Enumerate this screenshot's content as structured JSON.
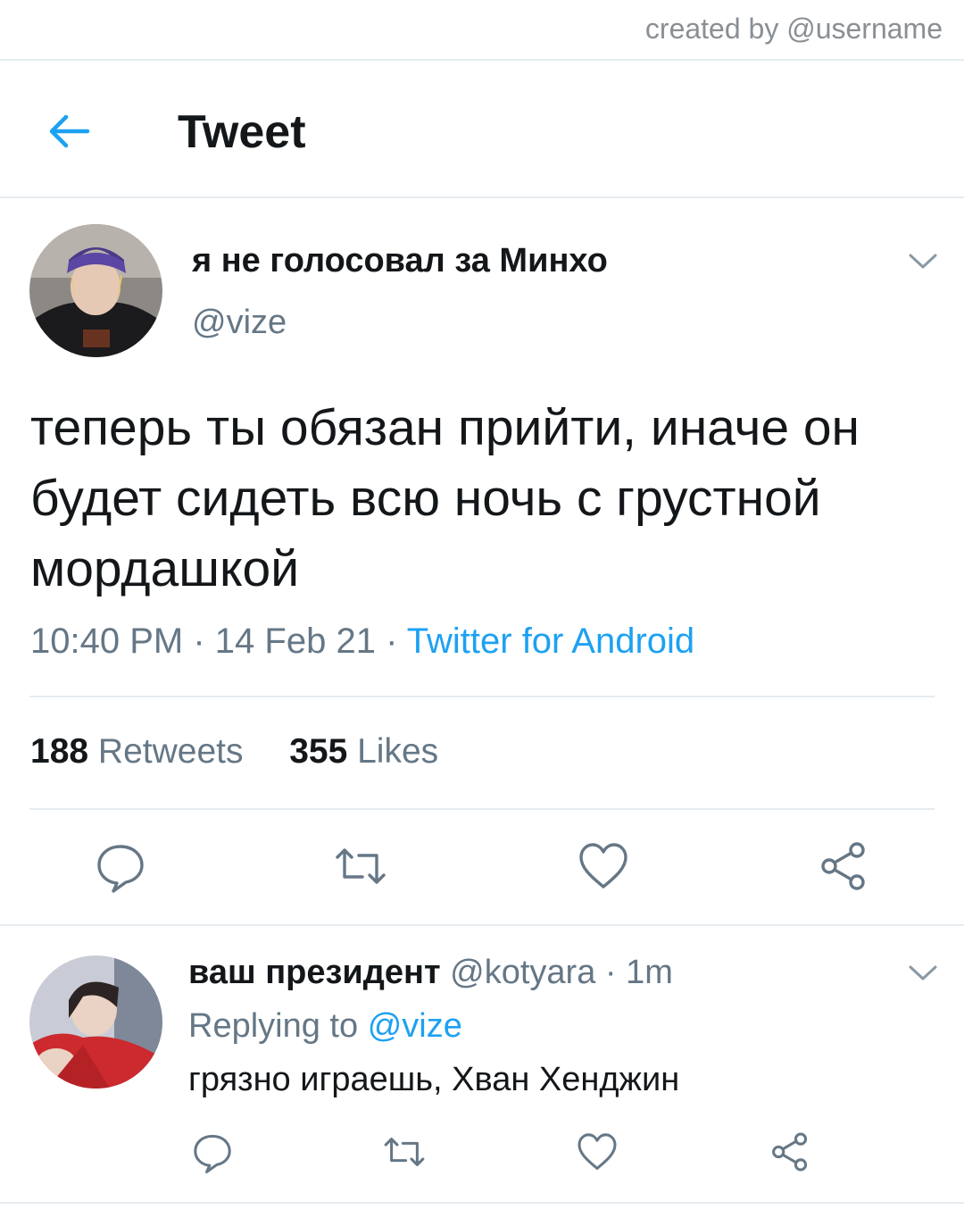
{
  "watermark": "created by @username",
  "header": {
    "title": "Tweet",
    "back_icon": "arrow-left-icon"
  },
  "tweet": {
    "author_name": "я не голосовал за Минхо",
    "author_handle": "@vize",
    "text": "теперь ты обязан прийти, иначе он будет сидеть всю ночь с грустной мордашкой",
    "time": "10:40 PM",
    "date": "14 Feb 21",
    "separator": "·",
    "source": "Twitter for Android",
    "retweets_count": "188",
    "retweets_label": "Retweets",
    "likes_count": "355",
    "likes_label": "Likes"
  },
  "reply": {
    "author_name": "ваш президент",
    "author_handle": "@kotyara",
    "separator": "·",
    "time": "1m",
    "replying_label": "Replying to",
    "replying_handle": "@vize",
    "text": "грязно играешь, Хван Хенджин"
  },
  "colors": {
    "accent": "#1da1f2",
    "muted": "#657786",
    "divider": "#e6ecf0"
  }
}
